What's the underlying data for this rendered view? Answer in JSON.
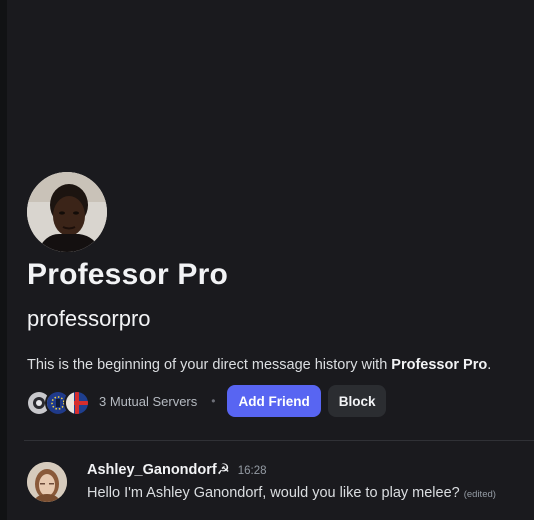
{
  "profile": {
    "display_name": "Professor Pro",
    "username": "professorpro",
    "intro_prefix": "This is the beginning of your direct message history with ",
    "intro_name": "Professor Pro",
    "intro_suffix": ".",
    "avatar_icon": "user-avatar-photo"
  },
  "mutual": {
    "label": "3 Mutual Servers",
    "separator": "•",
    "server_icons": [
      "server-icon-1",
      "server-icon-2",
      "server-icon-3"
    ]
  },
  "actions": {
    "add_friend_label": "Add Friend",
    "block_label": "Block"
  },
  "message": {
    "author": "Ashley_Ganondorf☭",
    "time": "16:28",
    "text": "Hello I'm Ashley Ganondorf, would you like to play melee?",
    "edited_label": "(edited)"
  },
  "colors": {
    "background": "#1a1a1e",
    "accent": "#5865f2",
    "secondary_button": "#2b2d31"
  }
}
